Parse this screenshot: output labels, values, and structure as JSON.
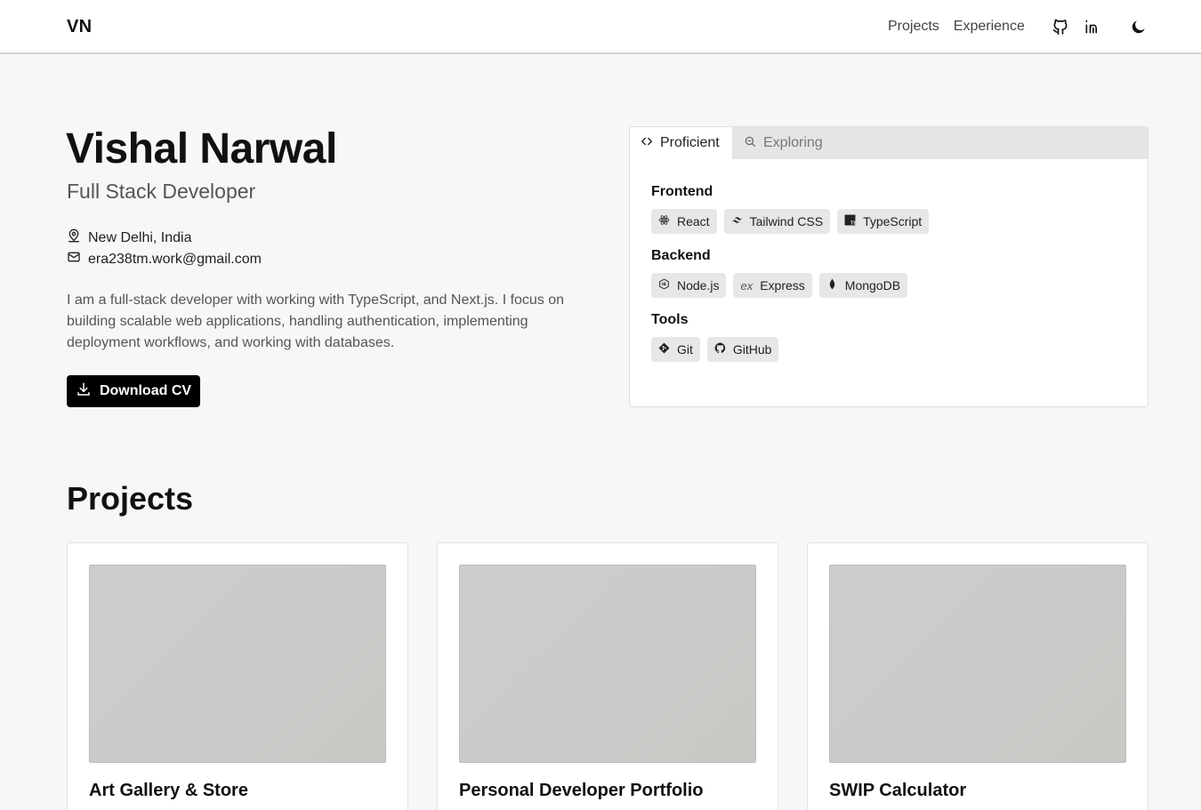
{
  "nav": {
    "logo": "VN",
    "links": [
      "Projects",
      "Experience"
    ],
    "icons": [
      "github-icon",
      "linkedin-icon",
      "moon-icon"
    ]
  },
  "hero": {
    "name": "Vishal Narwal",
    "role": "Full Stack Developer",
    "location": "New Delhi, India",
    "email": "era238tm.work@gmail.com",
    "bio": "I am a full-stack developer with working with TypeScript, and Next.js. I focus on building scalable web applications, handling authentication, implementing deployment workflows, and working with databases.",
    "cv_label": "Download CV"
  },
  "skills": {
    "tabs": [
      "Proficient",
      "Exploring"
    ],
    "active_tab": "Proficient",
    "groups": [
      {
        "title": "Frontend",
        "items": [
          "React",
          "Tailwind CSS",
          "TypeScript"
        ]
      },
      {
        "title": "Backend",
        "items": [
          "Node.js",
          "Express",
          "MongoDB"
        ]
      },
      {
        "title": "Tools",
        "items": [
          "Git",
          "GitHub"
        ]
      }
    ]
  },
  "projects": {
    "title": "Projects",
    "cards": [
      {
        "title": "Art Gallery & Store"
      },
      {
        "title": "Personal Developer Portfolio"
      },
      {
        "title": "SWIP Calculator"
      }
    ]
  },
  "colors": {
    "background": "#f6f7f9",
    "accent": "#000000",
    "chip": "#e7e7e7"
  }
}
